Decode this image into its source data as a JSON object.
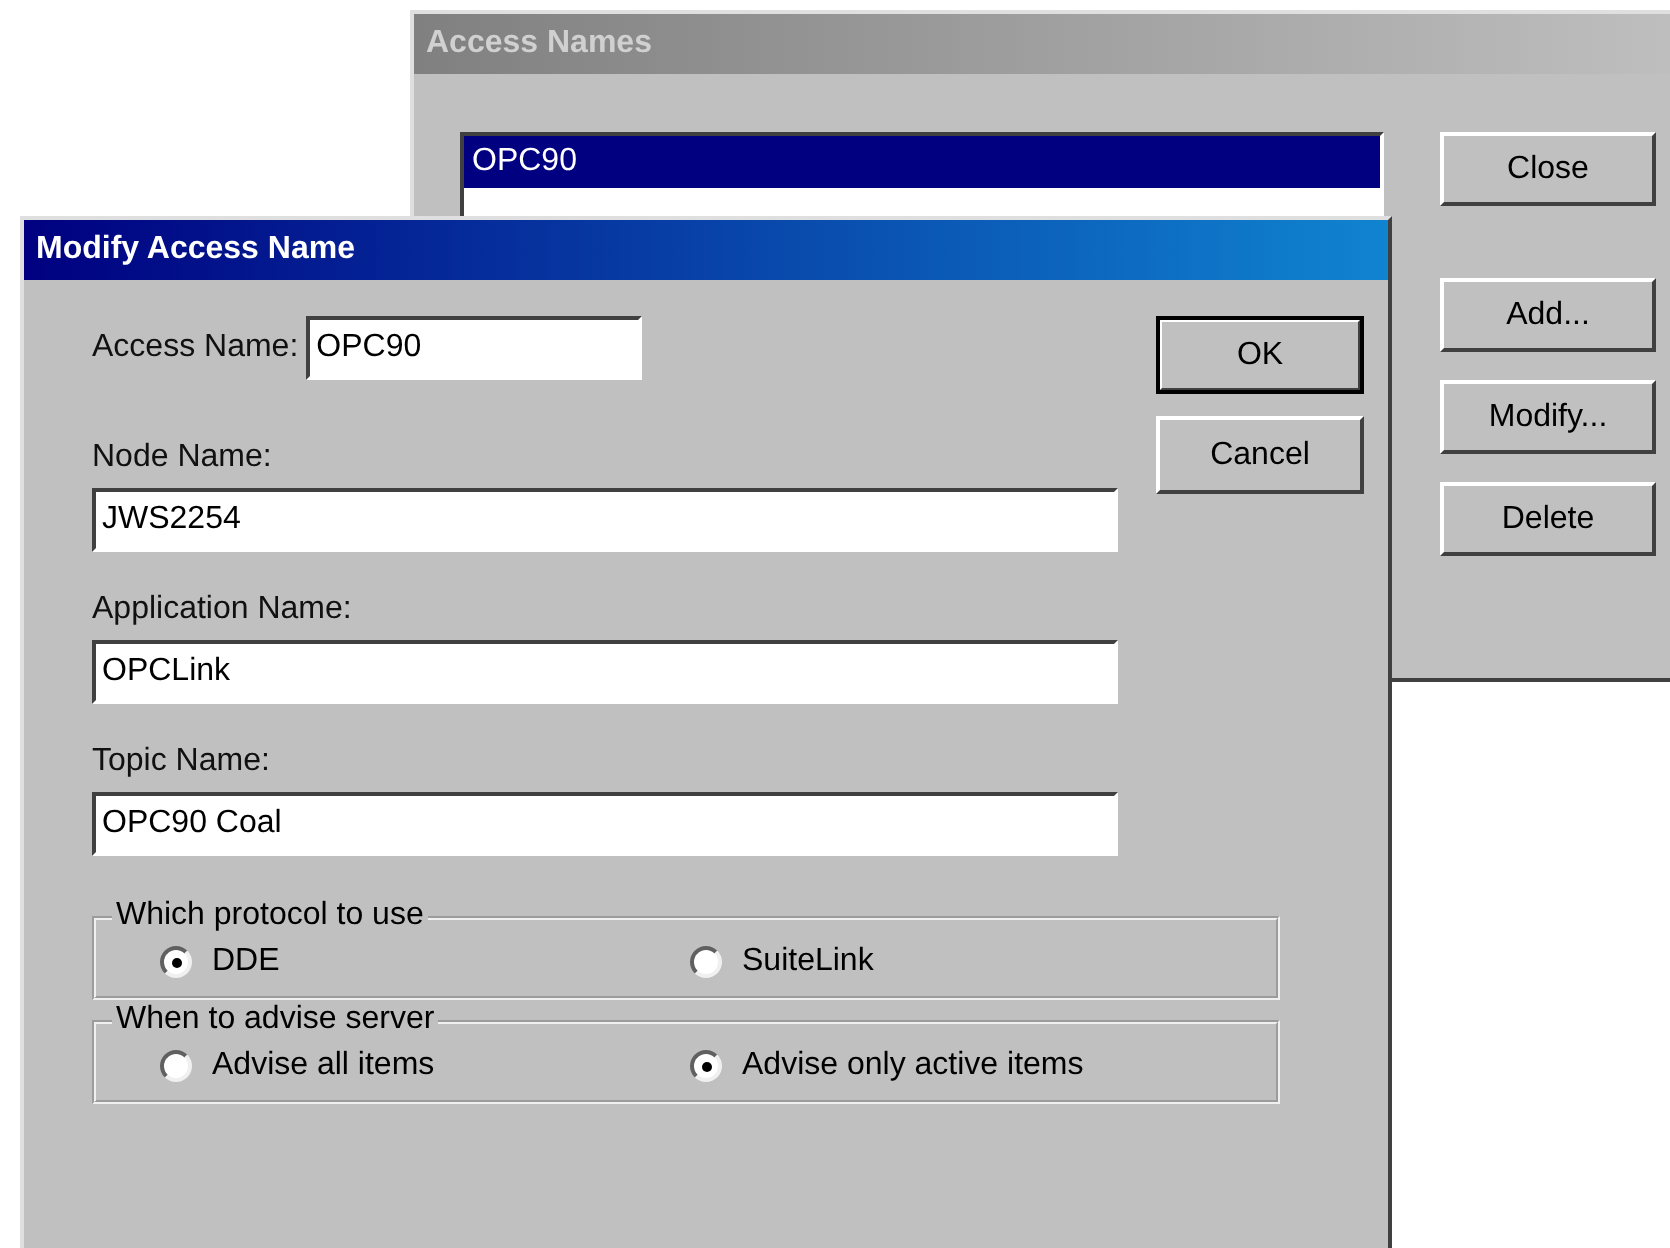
{
  "back_window": {
    "title": "Access Names",
    "active": false,
    "list": [
      {
        "text": "OPC90",
        "selected": true
      }
    ],
    "buttons": [
      "Close",
      "Add...",
      "Modify...",
      "Delete"
    ]
  },
  "dialog": {
    "title": "Modify Access Name",
    "active": true,
    "fields": [
      {
        "kind": "inline",
        "label": "Access Name:",
        "value": "OPC90"
      },
      {
        "kind": "stacked",
        "label": "Node Name:",
        "value": "JWS2254"
      },
      {
        "kind": "stacked",
        "label": "Application Name:",
        "value": "OPCLink"
      },
      {
        "kind": "stacked",
        "label": "Topic Name:",
        "value": "OPC90 Coal"
      }
    ],
    "buttons": [
      {
        "label": "OK",
        "default": true
      },
      {
        "label": "Cancel",
        "default": false
      }
    ],
    "groups": [
      {
        "legend": "Which protocol to use",
        "options": [
          {
            "label": "DDE",
            "selected": true
          },
          {
            "label": "SuiteLink",
            "selected": false
          }
        ]
      },
      {
        "legend": "When to advise server",
        "options": [
          {
            "label": "Advise all items",
            "selected": false
          },
          {
            "label": "Advise only active items",
            "selected": true
          }
        ]
      }
    ]
  }
}
